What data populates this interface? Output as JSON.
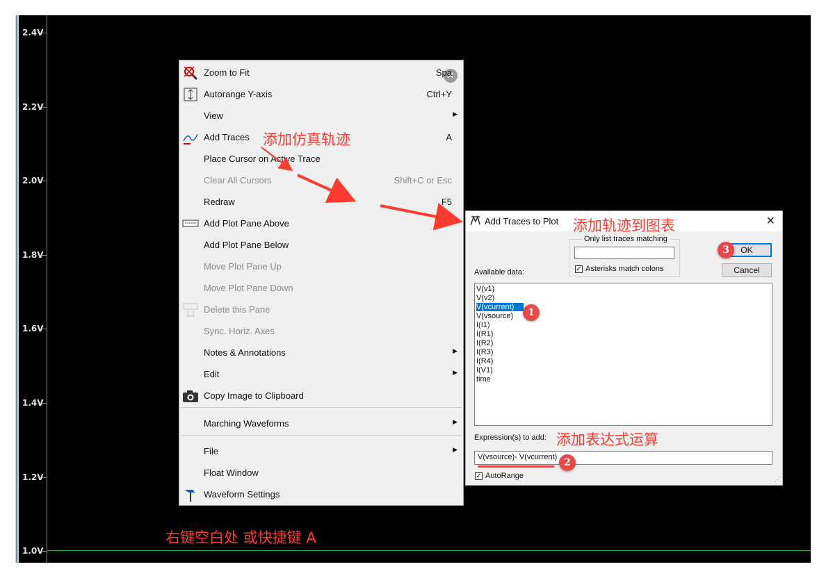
{
  "y_axis": {
    "ticks": [
      "2.4V",
      "2.2V",
      "2.0V",
      "1.8V",
      "1.6V",
      "1.4V",
      "1.2V",
      "1.0V"
    ]
  },
  "context_menu": {
    "items": [
      {
        "label": "Zoom to Fit",
        "shortcut": "Spa",
        "icon": "zoom-fit-icon"
      },
      {
        "label": "Autorange Y-axis",
        "shortcut": "Ctrl+Y",
        "icon": "autorange-icon"
      },
      {
        "label": "View",
        "submenu": true
      },
      {
        "label": "Add Traces",
        "shortcut": "A",
        "icon": "add-traces-icon"
      },
      {
        "label": "Place Cursor on Active Trace"
      },
      {
        "label": "Clear All Cursors",
        "shortcut": "Shift+C or Esc",
        "disabled": true
      },
      {
        "label": "Redraw",
        "shortcut": "F5"
      },
      {
        "label": "Add Plot Pane Above",
        "icon": "plot-pane-icon"
      },
      {
        "label": "Add Plot Pane Below"
      },
      {
        "label": "Move Plot Pane Up",
        "disabled": true
      },
      {
        "label": "Move Plot Pane Down",
        "disabled": true
      },
      {
        "label": "Delete this Pane",
        "disabled": true,
        "icon": "delete-pane-icon"
      },
      {
        "label": "Sync. Horiz. Axes",
        "disabled": true
      },
      {
        "label": "Notes & Annotations",
        "submenu": true
      },
      {
        "label": "Edit",
        "submenu": true
      },
      {
        "label": "Copy Image to Clipboard",
        "icon": "camera-icon"
      },
      {
        "label": "Marching Waveforms",
        "submenu": true
      },
      {
        "label": "File",
        "submenu": true
      },
      {
        "label": "Float Window"
      },
      {
        "label": "Waveform Settings",
        "icon": "hammer-icon"
      }
    ],
    "close_glyph": "✕"
  },
  "dialog": {
    "title": "Add Traces to Plot",
    "close_glyph": "✕",
    "filter_legend": "Only list traces matching",
    "filter_value": "",
    "asterisks_label": "Asterisks match colons",
    "asterisks_checked": "✓",
    "ok_label": "OK",
    "cancel_label": "Cancel",
    "available_label": "Available data:",
    "available_data": [
      "V(v1)",
      "V(v2)",
      "V(vcurrent)",
      "V(vsource)",
      "I(I1)",
      "I(R1)",
      "I(R2)",
      "I(R3)",
      "I(R4)",
      "I(V1)",
      "time"
    ],
    "selected_item": "V(vcurrent)",
    "expr_label": "Expression(s) to add:",
    "expr_value": "V(vsource)- V(vcurrent)",
    "autorange_label": "AutoRange",
    "autorange_checked": "✓"
  },
  "annotations": {
    "add_sim_traces": "添加仿真轨迹",
    "add_traces_to_chart": "添加轨迹到图表",
    "add_expression": "添加表达式运算",
    "right_click_hint": "右键空白处 或快捷键 A",
    "badge1": "1",
    "badge2": "2",
    "badge3": "3"
  },
  "colors": {
    "annotation_red": "#ff3b30",
    "trace_green": "#3aa83a",
    "selection_blue": "#0078d7"
  }
}
